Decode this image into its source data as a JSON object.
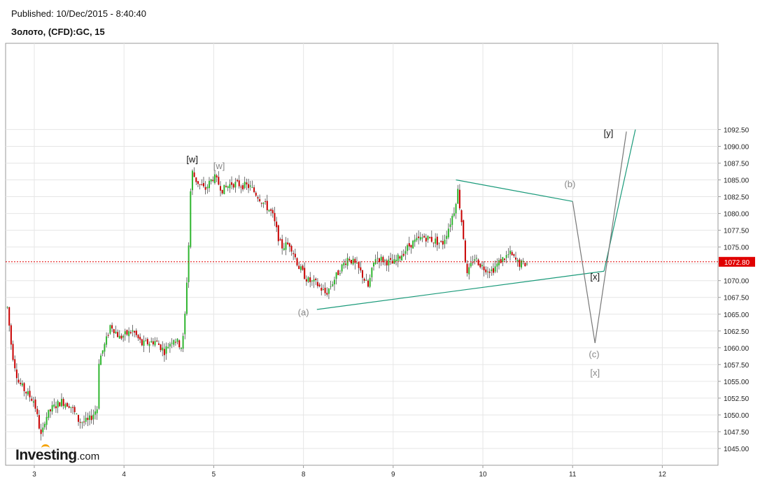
{
  "header": {
    "published": "Published: 10/Dec/2015 - 8:40:40",
    "symbol": "Золото, (CFD):GC, 15"
  },
  "logo": {
    "main": "Investing",
    "suffix": ".com"
  },
  "price_marker": {
    "label": "1072.80",
    "value": 1072.8,
    "color": "#e00000"
  },
  "colors": {
    "up": "#2fb52f",
    "down": "#c80000",
    "wick": "#333333",
    "trendline": "#1a9a7a",
    "projection": "#777777",
    "label_black": "#111111",
    "label_gray": "#888888",
    "grid": "#e6e6e6"
  },
  "chart_data": {
    "type": "candlestick",
    "xlabel": "",
    "ylabel": "",
    "ylim": [
      1043,
      1093.5
    ],
    "xlim": [
      2.7,
      13.0
    ],
    "y_ticks": [
      "1045.00",
      "1047.50",
      "1050.00",
      "1052.50",
      "1055.00",
      "1057.50",
      "1060.00",
      "1062.50",
      "1065.00",
      "1067.50",
      "1070.00",
      "1072.50",
      "1075.00",
      "1077.50",
      "1080.00",
      "1082.50",
      "1085.00",
      "1087.50",
      "1090.00",
      "1092.50"
    ],
    "x_ticks": [
      {
        "label": "3",
        "x": 3
      },
      {
        "label": "4",
        "x": 4
      },
      {
        "label": "5",
        "x": 5
      },
      {
        "label": "8",
        "x": 6
      },
      {
        "label": "9",
        "x": 7
      },
      {
        "label": "10",
        "x": 8
      },
      {
        "label": "11",
        "x": 9
      },
      {
        "label": "12",
        "x": 10
      }
    ],
    "grid": true,
    "price_path": [
      [
        2.7,
        1066.0
      ],
      [
        2.75,
        1059.5
      ],
      [
        2.82,
        1055.0
      ],
      [
        2.9,
        1053.5
      ],
      [
        3.0,
        1052.0
      ],
      [
        3.08,
        1046.5
      ],
      [
        3.12,
        1049.5
      ],
      [
        3.2,
        1051.0
      ],
      [
        3.3,
        1052.0
      ],
      [
        3.4,
        1051.5
      ],
      [
        3.5,
        1049.0
      ],
      [
        3.6,
        1049.0
      ],
      [
        3.7,
        1051.0
      ],
      [
        3.72,
        1058.0
      ],
      [
        3.8,
        1061.0
      ],
      [
        3.85,
        1063.5
      ],
      [
        3.95,
        1061.5
      ],
      [
        4.1,
        1062.5
      ],
      [
        4.2,
        1060.5
      ],
      [
        4.35,
        1061.0
      ],
      [
        4.45,
        1059.5
      ],
      [
        4.55,
        1061.5
      ],
      [
        4.65,
        1060.0
      ],
      [
        4.68,
        1065.0
      ],
      [
        4.72,
        1075.0
      ],
      [
        4.75,
        1086.5
      ],
      [
        4.8,
        1085.0
      ],
      [
        4.9,
        1083.5
      ],
      [
        5.0,
        1085.5
      ],
      [
        5.1,
        1083.5
      ],
      [
        5.2,
        1084.5
      ],
      [
        5.4,
        1084.0
      ],
      [
        5.5,
        1082.5
      ],
      [
        5.65,
        1080.0
      ],
      [
        5.75,
        1075.0
      ],
      [
        5.85,
        1075.5
      ],
      [
        5.95,
        1072.0
      ],
      [
        6.05,
        1070.0
      ],
      [
        6.15,
        1069.5
      ],
      [
        6.25,
        1068.0
      ],
      [
        6.4,
        1071.5
      ],
      [
        6.5,
        1073.5
      ],
      [
        6.6,
        1072.0
      ],
      [
        6.65,
        1071.0
      ],
      [
        6.72,
        1069.0
      ],
      [
        6.8,
        1073.5
      ],
      [
        6.9,
        1073.0
      ],
      [
        7.0,
        1072.5
      ],
      [
        7.1,
        1074.0
      ],
      [
        7.2,
        1075.5
      ],
      [
        7.35,
        1076.5
      ],
      [
        7.45,
        1076.0
      ],
      [
        7.55,
        1075.5
      ],
      [
        7.62,
        1078.0
      ],
      [
        7.68,
        1080.5
      ],
      [
        7.72,
        1083.5
      ],
      [
        7.78,
        1077.0
      ],
      [
        7.82,
        1070.5
      ],
      [
        7.9,
        1073.5
      ],
      [
        8.0,
        1072.0
      ],
      [
        8.1,
        1071.5
      ],
      [
        8.2,
        1073.0
      ],
      [
        8.3,
        1074.0
      ],
      [
        8.4,
        1072.5
      ],
      [
        8.5,
        1072.5
      ]
    ],
    "annotations": [
      {
        "text": "[w]",
        "x": 4.76,
        "y": 1087.6,
        "style": "black"
      },
      {
        "text": "[w]",
        "x": 5.06,
        "y": 1086.6,
        "style": "gray"
      },
      {
        "text": "(a)",
        "x": 6.0,
        "y": 1064.8,
        "style": "gray"
      },
      {
        "text": "(b)",
        "x": 8.97,
        "y": 1083.9,
        "style": "gray"
      },
      {
        "text": "(c)",
        "x": 9.24,
        "y": 1058.6,
        "style": "gray"
      },
      {
        "text": "[x]",
        "x": 9.25,
        "y": 1070.1,
        "style": "black"
      },
      {
        "text": "[x]",
        "x": 9.25,
        "y": 1055.8,
        "style": "gray"
      },
      {
        "text": "[y]",
        "x": 9.4,
        "y": 1091.5,
        "style": "black"
      }
    ],
    "trendlines": [
      {
        "from": [
          6.15,
          1065.7
        ],
        "to": [
          9.35,
          1071.4
        ],
        "style": "trendline"
      },
      {
        "from": [
          7.7,
          1085.0
        ],
        "to": [
          9.0,
          1081.8
        ],
        "style": "trendline"
      },
      {
        "from": [
          9.35,
          1071.4
        ],
        "to": [
          9.7,
          1092.5
        ],
        "style": "trendline"
      },
      {
        "from": [
          9.0,
          1081.8
        ],
        "to": [
          9.25,
          1060.7
        ],
        "style": "projection"
      },
      {
        "from": [
          9.25,
          1060.7
        ],
        "to": [
          9.6,
          1092.2
        ],
        "style": "projection"
      }
    ]
  }
}
